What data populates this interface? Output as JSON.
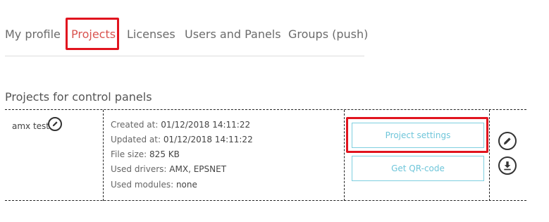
{
  "tabs": [
    {
      "label": "My profile",
      "active": false
    },
    {
      "label": "Projects",
      "active": true
    },
    {
      "label": "Licenses",
      "active": false
    },
    {
      "label": "Users and Panels",
      "active": false
    },
    {
      "label": "Groups (push)",
      "active": false
    }
  ],
  "section": {
    "title": "Projects for control panels"
  },
  "projects": [
    {
      "name": "amx test",
      "created_label": "Created at:",
      "created": "01/12/2018 14:11:22",
      "updated_label": "Updated at:",
      "updated": "01/12/2018 14:11:22",
      "file_size_label": "File size:",
      "file_size": "825 KB",
      "drivers_label": "Used drivers:",
      "drivers": "AMX, EPSNET",
      "modules_label": "Used modules:",
      "modules": "none",
      "settings_button": "Project settings",
      "qr_button": "Get QR-code"
    }
  ],
  "icons": {
    "name_edit": "pencil-icon",
    "row_edit": "pencil-icon",
    "row_download": "download-icon"
  },
  "colors": {
    "active_tab": "#d9534f",
    "highlight": "#e1141e",
    "button_border": "#7ecfe0",
    "button_text": "#6fc6da"
  }
}
